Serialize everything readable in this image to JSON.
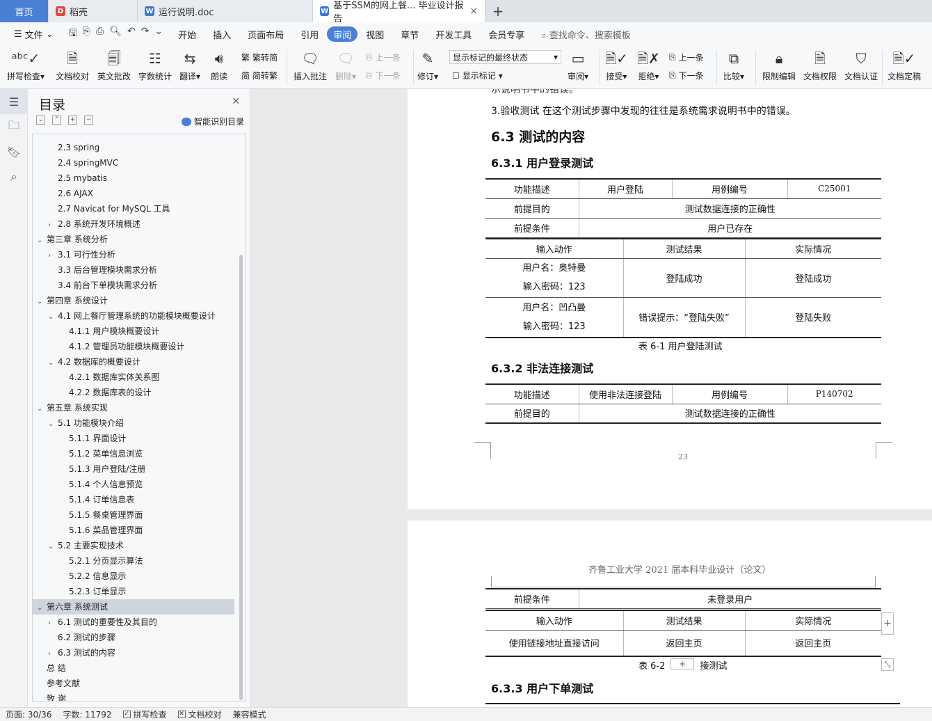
{
  "tabs": {
    "home": "首页",
    "t1": "稻壳",
    "t2": "运行说明.doc",
    "active": "基于SSM的网上餐... 毕业设计报告",
    "close": "×",
    "add": "+"
  },
  "menu": {
    "file": "文件",
    "items": [
      "开始",
      "插入",
      "页面布局",
      "引用",
      "审阅",
      "视图",
      "章节",
      "开发工具",
      "会员专享"
    ],
    "search": "查找命令、搜索模板"
  },
  "ribbon": {
    "spell": "拼写检查",
    "proof": "文档校对",
    "eng": "英文批改",
    "count": "字数统计",
    "translate": "翻译",
    "read": "朗读",
    "trad": "繁转简",
    "simp": "简转繁",
    "insert_comment": "插入批注",
    "delete": "删除",
    "prev": "上一条",
    "next": "下一条",
    "revise": "修订",
    "markup_state": "显示标记的最终状态",
    "show_markup": "显示标记",
    "review": "审阅",
    "accept": "接受",
    "reject": "拒绝",
    "prev2": "上一条",
    "next2": "下一条",
    "compare": "比较",
    "restrict": "限制编辑",
    "perm": "文档权限",
    "auth": "文档认证",
    "final": "文档定稿"
  },
  "toc": {
    "title": "目录",
    "smart": "智能识别目录",
    "items": [
      {
        "t": "2.3 spring",
        "lvl": 2,
        "tw": ""
      },
      {
        "t": "2.4 springMVC",
        "lvl": 2,
        "tw": ""
      },
      {
        "t": "2.5 mybatis",
        "lvl": 2,
        "tw": ""
      },
      {
        "t": "2.6 AJAX",
        "lvl": 2,
        "tw": ""
      },
      {
        "t": "2.7 Navicat for MySQL 工具",
        "lvl": 2,
        "tw": ""
      },
      {
        "t": "2.8 系统开发环境概述",
        "lvl": 2,
        "tw": ">"
      },
      {
        "t": "第三章  系统分析",
        "lvl": 1,
        "tw": "v"
      },
      {
        "t": "3.1 可行性分析",
        "lvl": 2,
        "tw": ">"
      },
      {
        "t": "3.3 后台管理模块需求分析",
        "lvl": 2,
        "tw": ""
      },
      {
        "t": "3.4 前台下单模块需求分析",
        "lvl": 2,
        "tw": ""
      },
      {
        "t": "第四章  系统设计",
        "lvl": 1,
        "tw": "v"
      },
      {
        "t": "4.1 网上餐厅管理系统的功能模块概要设计",
        "lvl": 2,
        "tw": "v"
      },
      {
        "t": "4.1.1 用户模块概要设计",
        "lvl": 3,
        "tw": ""
      },
      {
        "t": "4.1.2 管理员功能模块概要设计",
        "lvl": 3,
        "tw": ""
      },
      {
        "t": "4.2 数据库的概要设计",
        "lvl": 2,
        "tw": "v"
      },
      {
        "t": "4.2.1 数据库实体关系图",
        "lvl": 3,
        "tw": ""
      },
      {
        "t": "4.2.2 数据库表的设计",
        "lvl": 3,
        "tw": ""
      },
      {
        "t": "第五章  系统实现",
        "lvl": 1,
        "tw": "v"
      },
      {
        "t": "5.1 功能模块介绍",
        "lvl": 2,
        "tw": "v"
      },
      {
        "t": "5.1.1 界面设计",
        "lvl": 3,
        "tw": ""
      },
      {
        "t": "5.1.2  菜单信息浏览",
        "lvl": 3,
        "tw": ""
      },
      {
        "t": "5.1.3  用户登陆/注册",
        "lvl": 3,
        "tw": ""
      },
      {
        "t": "5.1.4  个人信息预览",
        "lvl": 3,
        "tw": ""
      },
      {
        "t": "5.1.4  订单信息表",
        "lvl": 3,
        "tw": ""
      },
      {
        "t": "5.1.5  餐桌管理界面",
        "lvl": 3,
        "tw": ""
      },
      {
        "t": "5.1.6  菜品管理界面",
        "lvl": 3,
        "tw": ""
      },
      {
        "t": "5.2 主要实现技术",
        "lvl": 2,
        "tw": "v"
      },
      {
        "t": "5.2.1 分页显示算法",
        "lvl": 3,
        "tw": ""
      },
      {
        "t": "5.2.2  信息显示",
        "lvl": 3,
        "tw": ""
      },
      {
        "t": "5.2.3  订单显示",
        "lvl": 3,
        "tw": ""
      },
      {
        "t": "第六章  系统测试",
        "lvl": 1,
        "tw": "v",
        "sel": true
      },
      {
        "t": "6.1 测试的重要性及其目的",
        "lvl": 2,
        "tw": ">"
      },
      {
        "t": "6.2 测试的步骤",
        "lvl": 2,
        "tw": ""
      },
      {
        "t": "6.3 测试的内容",
        "lvl": 2,
        "tw": ">"
      },
      {
        "t": "总   结",
        "lvl": 1,
        "tw": ""
      },
      {
        "t": "参考文献",
        "lvl": 1,
        "tw": ""
      },
      {
        "t": "致   谢",
        "lvl": 1,
        "tw": ""
      }
    ]
  },
  "doc": {
    "cut_line": "示说明书中的错误。",
    "line3": "3.验收测试 在这个测试步骤中发现的往往是系统需求说明书中的错误。",
    "h63": "6.3 测试的内容",
    "h631": "6.3.1 用户登录测试",
    "t1": {
      "r1": [
        "功能描述",
        "用户登陆",
        "用例编号",
        "C25001"
      ],
      "r2": [
        "前提目的",
        "测试数据连接的正确性"
      ],
      "r3": [
        "前提条件",
        "用户已存在"
      ],
      "r4": [
        "输入动作",
        "测试结果",
        "实际情况"
      ],
      "r5a": "用户名：奥特曼",
      "r5b": "输入密码：123",
      "r5c": "登陆成功",
      "r5d": "登陆成功",
      "r6a": "用户名：凹凸曼",
      "r6b": "输入密码：123",
      "r6c": "错误提示：“登陆失败”",
      "r6d": "登陆失败"
    },
    "cap1": "表 6-1  用户登陆测试",
    "h632": "6.3.2 非法连接测试",
    "t2": {
      "r1": [
        "功能描述",
        "使用非法连接登陆",
        "用例编号",
        "P140702"
      ],
      "r2": [
        "前提目的",
        "测试数据连接的正确性"
      ]
    },
    "pagenum": "23",
    "header2": "齐鲁工业大学 2021 届本科毕业设计（论文）",
    "t3": {
      "r1": [
        "前提条件",
        "未登录用户"
      ],
      "r2": [
        "输入动作",
        "测试结果",
        "实际情况"
      ],
      "r3": [
        "使用链接地址直接访问",
        "返回主页",
        "返回主页"
      ]
    },
    "cap2": "表 6-2  非法连接测试",
    "cap2_visible": "接测试",
    "h633": "6.3.3  用户下单测试"
  },
  "status": {
    "page": "页面: 30/36",
    "words": "字数: 11792",
    "spell": "拼写检查",
    "proof": "文档校对",
    "compat": "兼容模式"
  }
}
